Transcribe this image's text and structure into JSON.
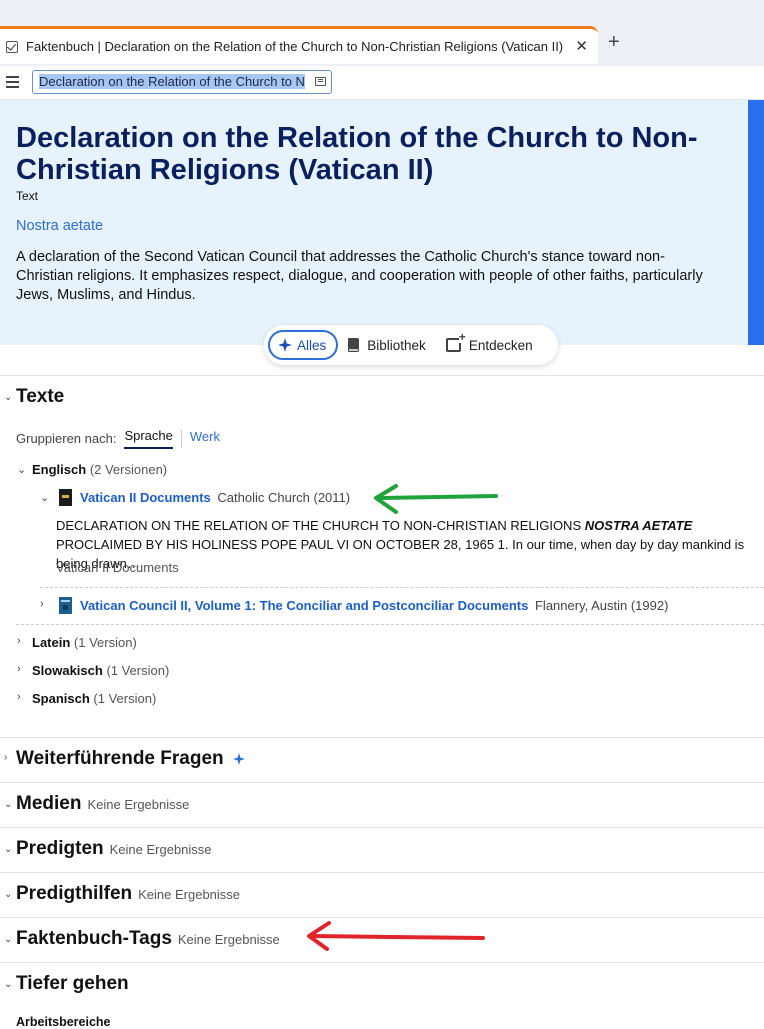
{
  "browser": {
    "tab_title": "Faktenbuch | Declaration on the Relation of the Church to Non-Christian Religions (Vatican II)",
    "close_glyph": "✕",
    "new_tab_glyph": "+",
    "address_text": "Declaration on the Relation of the Church to N"
  },
  "hero": {
    "title": "Declaration on the Relation of the Church to Non-Christian Religions (Vatican II)",
    "type": "Text",
    "alias": "Nostra aetate",
    "description": "A declaration of the Second Vatican Council that addresses the Catholic Church's stance toward non-Christian religions. It emphasizes respect, dialogue, and cooperation with people of other faiths, particularly Jews, Muslims, and Hindus."
  },
  "pills": {
    "all": "Alles",
    "library": "Bibliothek",
    "discover": "Entdecken"
  },
  "texts": {
    "title": "Texte",
    "group_label": "Gruppieren nach:",
    "group_tabs": [
      "Sprache",
      "Werk"
    ],
    "languages": [
      {
        "name": "Englisch",
        "count": "(2 Versionen)"
      },
      {
        "name": "Latein",
        "count": "(1 Version)"
      },
      {
        "name": "Slowakisch",
        "count": "(1 Version)"
      },
      {
        "name": "Spanisch",
        "count": "(1 Version)"
      }
    ],
    "books": [
      {
        "title": "Vatican II Documents",
        "meta": "Catholic Church (2011)"
      },
      {
        "title": "Vatican Council II, Volume 1: The Conciliar and Postconciliar Documents",
        "meta": "Flannery, Austin (1992)"
      }
    ],
    "excerpt_before": "DECLARATION ON THE RELATION OF THE CHURCH TO NON-CHRISTIAN RELIGIONS ",
    "excerpt_em": "NOSTRA AETATE",
    "excerpt_after": " PROCLAIMED BY HIS HOLINESS POPE PAUL VI ON OCTOBER 28, 1965 1. In our time, when day by day mankind is being drawn…",
    "excerpt_source": "Vatican II Documents"
  },
  "sections": [
    {
      "title": "Weiterführende Fragen",
      "note": ""
    },
    {
      "title": "Medien",
      "note": "Keine Ergebnisse"
    },
    {
      "title": "Predigten",
      "note": "Keine Ergebnisse"
    },
    {
      "title": "Predigthilfen",
      "note": "Keine Ergebnisse"
    },
    {
      "title": "Faktenbuch-Tags",
      "note": "Keine Ergebnisse"
    },
    {
      "title": "Tiefer gehen",
      "note": ""
    }
  ],
  "deeper": {
    "sub_label": "Arbeitsbereiche"
  },
  "colors": {
    "accent": "#2c6fd6",
    "title_navy": "#0a1f5e",
    "hero_bg": "#e6f3fd",
    "arrow_green": "#1fa33a",
    "arrow_red": "#e0242a",
    "tab_accent": "#f07b1c"
  }
}
